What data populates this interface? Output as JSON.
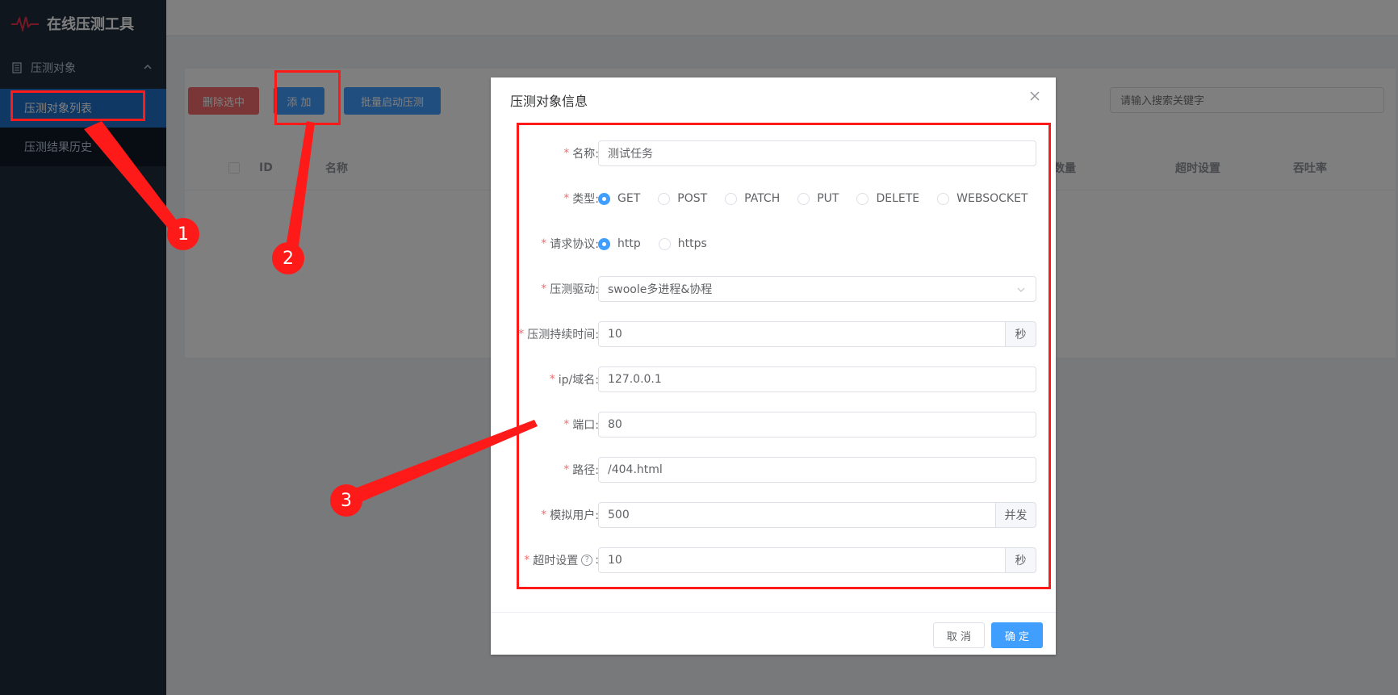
{
  "app": {
    "title": "在线压测工具"
  },
  "sidebar": {
    "group_label": "压测对象",
    "items": [
      {
        "label": "压测对象列表",
        "active": true
      },
      {
        "label": "压测结果历史",
        "active": false
      }
    ]
  },
  "toolbar": {
    "delete_label": "删除选中",
    "add_label": "添 加",
    "batch_label": "批量启动压测",
    "search_placeholder": "请输入搜索关键字"
  },
  "table": {
    "headers": [
      "ID",
      "名称",
      "数量",
      "超时设置",
      "吞吐率"
    ]
  },
  "dialog": {
    "title": "压测对象信息",
    "fields": {
      "name": {
        "label": "名称:",
        "value": "测试任务"
      },
      "type": {
        "label": "类型:",
        "options": [
          "GET",
          "POST",
          "PATCH",
          "PUT",
          "DELETE",
          "WEBSOCKET"
        ],
        "selected": "GET"
      },
      "protocol": {
        "label": "请求协议:",
        "options": [
          "http",
          "https"
        ],
        "selected": "http"
      },
      "driver": {
        "label": "压测驱动:",
        "value": "swoole多进程&协程"
      },
      "duration": {
        "label": "压测持续时间:",
        "value": "10",
        "unit": "秒"
      },
      "host": {
        "label": "ip/域名:",
        "value": "127.0.0.1"
      },
      "port": {
        "label": "端口:",
        "value": "80"
      },
      "path": {
        "label": "路径:",
        "value": "/404.html"
      },
      "users": {
        "label": "模拟用户:",
        "value": "500",
        "unit": "并发"
      },
      "timeout": {
        "label": "超时设置",
        "colon": ":",
        "value": "10",
        "unit": "秒",
        "help": "?"
      }
    },
    "cancel_label": "取 消",
    "ok_label": "确 定"
  },
  "annotations": {
    "badge1": "1",
    "badge2": "2",
    "badge3": "3"
  },
  "colors": {
    "annotation": "#ff1a1a",
    "primary": "#409eff",
    "danger": "#f56c6c",
    "sidebar": "#1f2d3d"
  }
}
